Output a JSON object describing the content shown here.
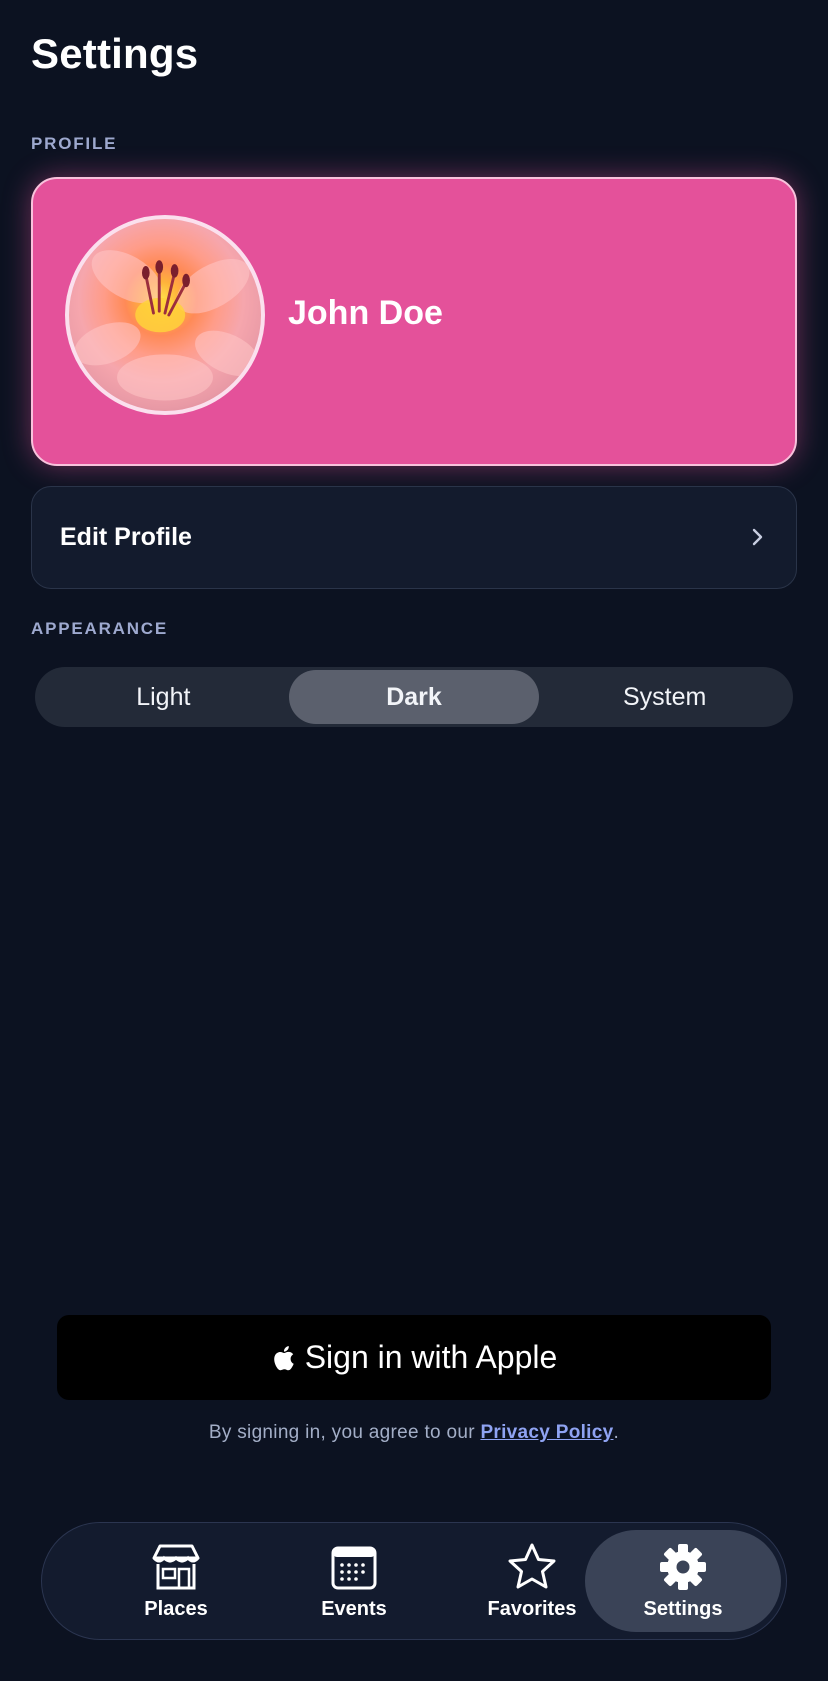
{
  "header": {
    "title": "Settings"
  },
  "profile": {
    "section_label": "PROFILE",
    "name": "John Doe",
    "card_color": "#e4519a",
    "avatar_icon": "flower-avatar"
  },
  "edit_profile": {
    "label": "Edit Profile",
    "icon": "chevron-right-icon"
  },
  "appearance": {
    "section_label": "APPEARANCE",
    "options": [
      "Light",
      "Dark",
      "System"
    ],
    "selected": "Dark"
  },
  "signin": {
    "button_label": "Sign in with Apple",
    "legal_prefix": "By signing in, you agree to our ",
    "legal_link": "Privacy Policy",
    "legal_suffix": "."
  },
  "tabbar": {
    "items": [
      {
        "label": "Places",
        "icon": "storefront-icon"
      },
      {
        "label": "Events",
        "icon": "calendar-icon"
      },
      {
        "label": "Favorites",
        "icon": "star-icon"
      },
      {
        "label": "Settings",
        "icon": "gear-icon"
      }
    ],
    "active": "Settings"
  },
  "colors": {
    "background": "#0c1221",
    "accent_link": "#8fa3f2",
    "section_label": "#9ea9cf"
  }
}
